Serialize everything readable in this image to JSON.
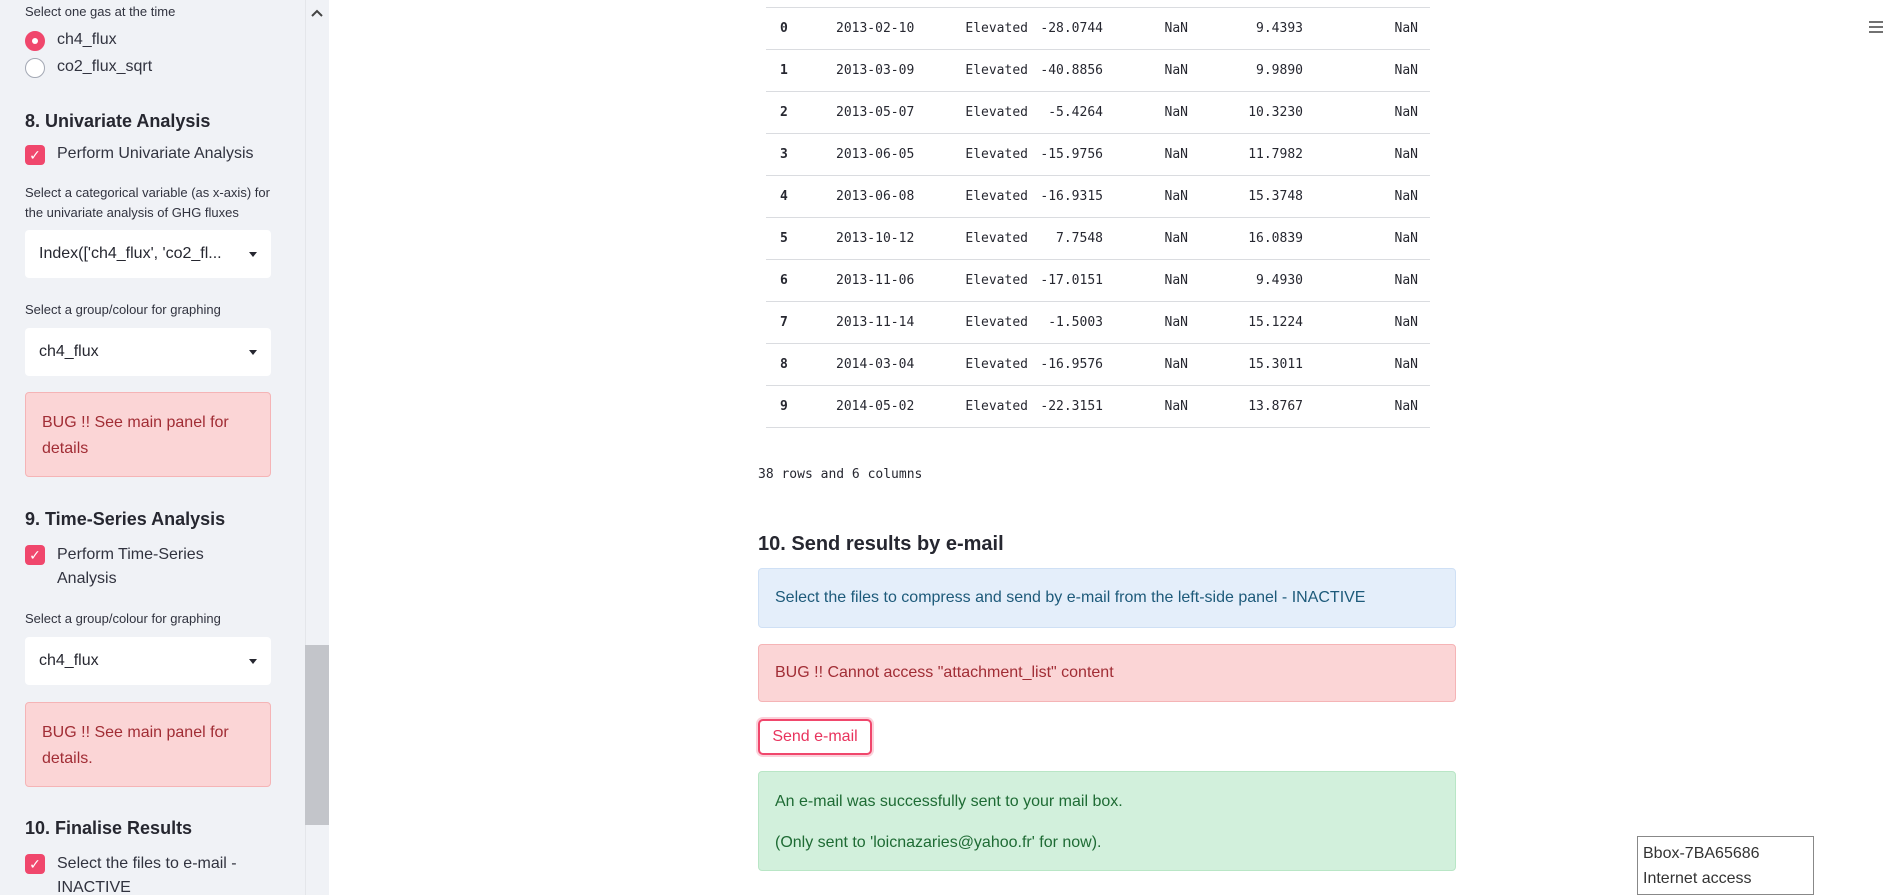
{
  "sidebar": {
    "gas_prompt": "Select one gas at the time",
    "gas_options": [
      {
        "label": "ch4_flux",
        "selected": true
      },
      {
        "label": "co2_flux_sqrt",
        "selected": false
      }
    ],
    "sec8": {
      "title": "8. Univariate Analysis",
      "checkbox_label": "Perform Univariate Analysis",
      "checked": true,
      "var_prompt": "Select a categorical variable (as x-axis) for the univariate analysis of GHG fluxes",
      "var_value": "Index(['ch4_flux', 'co2_fl...",
      "group_prompt": "Select a group/colour for graphing",
      "group_value": "ch4_flux",
      "error": "BUG !! See main panel for details"
    },
    "sec9": {
      "title": "9. Time-Series Analysis",
      "checkbox_label": "Perform Time-Series Analysis",
      "checked": true,
      "group_prompt": "Select a group/colour for graphing",
      "group_value": "ch4_flux",
      "error": "BUG !! See main panel for details."
    },
    "sec10": {
      "title": "10. Finalise Results",
      "checkbox_label": "Select the files to e-mail - INACTIVE",
      "checked": true
    }
  },
  "table": {
    "rows": [
      [
        "0",
        "2013-02-10",
        "Elevated",
        "-28.0744",
        "NaN",
        "9.4393",
        "NaN"
      ],
      [
        "1",
        "2013-03-09",
        "Elevated",
        "-40.8856",
        "NaN",
        "9.9890",
        "NaN"
      ],
      [
        "2",
        "2013-05-07",
        "Elevated",
        "-5.4264",
        "NaN",
        "10.3230",
        "NaN"
      ],
      [
        "3",
        "2013-06-05",
        "Elevated",
        "-15.9756",
        "NaN",
        "11.7982",
        "NaN"
      ],
      [
        "4",
        "2013-06-08",
        "Elevated",
        "-16.9315",
        "NaN",
        "15.3748",
        "NaN"
      ],
      [
        "5",
        "2013-10-12",
        "Elevated",
        "7.7548",
        "NaN",
        "16.0839",
        "NaN"
      ],
      [
        "6",
        "2013-11-06",
        "Elevated",
        "-17.0151",
        "NaN",
        "9.4930",
        "NaN"
      ],
      [
        "7",
        "2013-11-14",
        "Elevated",
        "-1.5003",
        "NaN",
        "15.1224",
        "NaN"
      ],
      [
        "8",
        "2014-03-04",
        "Elevated",
        "-16.9576",
        "NaN",
        "15.3011",
        "NaN"
      ],
      [
        "9",
        "2014-05-02",
        "Elevated",
        "-22.3151",
        "NaN",
        "13.8767",
        "NaN"
      ]
    ],
    "summary": "38 rows and 6 columns"
  },
  "email": {
    "heading": "10. Send results by e-mail",
    "info": "Select the files to compress and send by e-mail from the left-side panel - INACTIVE",
    "bug": "BUG !! Cannot access \"attachment_list\" content",
    "send_label": "Send e-mail",
    "success_line1": "An e-mail was successfully sent to your mail box.",
    "success_line2": "(Only sent to 'loicnazaries@yahoo.fr' for now)."
  },
  "overlay": {
    "line1": "Bbox-7BA65686",
    "line2": "Internet access"
  },
  "colors": {
    "accent": "#f0476c",
    "sidebar_bg": "#f0f2f6",
    "error_bg": "#fbd5d6",
    "info_bg": "#e4eefa",
    "success_bg": "#d2f0dc"
  },
  "icons": [
    "chevron-up-icon",
    "menu-icon",
    "caret-down-icon",
    "check-icon"
  ]
}
